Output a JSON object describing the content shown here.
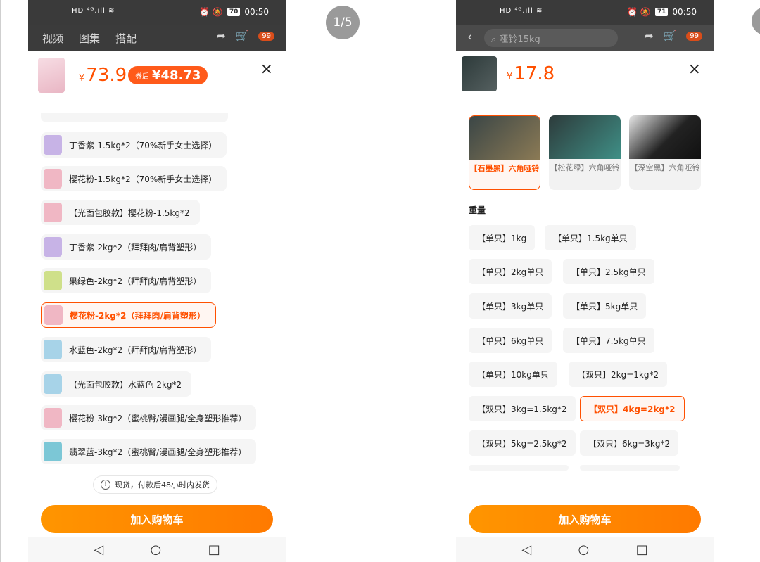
{
  "pager": {
    "label": "1/5"
  },
  "panel1": {
    "status": {
      "left": "HD ⁴ᴳ.ıll ≋",
      "time": "00:50",
      "battery": "70",
      "icons": "⏰ 🔕"
    },
    "nav": {
      "tabs": [
        "视频",
        "图集",
        "搭配"
      ],
      "badge": "99"
    },
    "price_currency": "¥",
    "price": "73.9",
    "coupon_prefix": "券后",
    "coupon_price": "¥48.73",
    "close": "×",
    "options": [
      {
        "label": "丁香紫-1.5kg*2（70%新手女士选择）",
        "color": "#c7b3e6"
      },
      {
        "label": "樱花粉-1.5kg*2（70%新手女士选择）",
        "color": "#f0b7c4"
      },
      {
        "label": "【光面包胶款】樱花粉-1.5kg*2",
        "color": "#f0b7c4"
      },
      {
        "label": "丁香紫-2kg*2（拜拜肉/肩背塑形）",
        "color": "#c7b3e6"
      },
      {
        "label": "果绿色-2kg*2（拜拜肉/肩背塑形）",
        "color": "#cfe08a"
      },
      {
        "label": "樱花粉-2kg*2（拜拜肉/肩背塑形）",
        "color": "#f0b7c4",
        "selected": true
      },
      {
        "label": "水蓝色-2kg*2（拜拜肉/肩背塑形）",
        "color": "#a7d3e8"
      },
      {
        "label": "【光面包胶款】水蓝色-2kg*2",
        "color": "#a7d3e8"
      },
      {
        "label": "樱花粉-3kg*2（蜜桃臀/漫画腿/全身塑形推荐）",
        "color": "#f0b7c4"
      },
      {
        "label": "翡翠蓝-3kg*2（蜜桃臀/漫画腿/全身塑形推荐）",
        "color": "#7cc7d6"
      }
    ],
    "notice": "现货，付款后48小时内发货",
    "cart_button": "加入购物车"
  },
  "panel2": {
    "status": {
      "left": "HD ⁴ᴳ.ıll ≋",
      "time": "00:50",
      "battery": "71",
      "icons": "⏰ 🔕"
    },
    "nav": {
      "search": "哑铃15kg",
      "badge": "99"
    },
    "price_currency": "¥",
    "price": "17.8",
    "close": "×",
    "colors": [
      {
        "label": "【石墨黑】六角哑铃",
        "selected": true
      },
      {
        "label": "【松花绿】六角哑铃"
      },
      {
        "label": "【深空黑】六角哑铃"
      }
    ],
    "weight_title": "重量",
    "weights": [
      "【单只】1kg",
      "【单只】1.5kg单只",
      "【单只】2kg单只",
      "【单只】2.5kg单只",
      "【单只】3kg单只",
      "【单只】5kg单只",
      "【单只】6kg单只",
      "【单只】7.5kg单只",
      "【单只】10kg单只",
      "【双只】2kg=1kg*2",
      "【双只】3kg=1.5kg*2",
      "【双只】4kg=2kg*2",
      "【双只】5kg=2.5kg*2",
      "【双只】6kg=3kg*2"
    ],
    "selected_weight_index": 11,
    "cart_button": "加入购物车"
  },
  "sysnav": {
    "back": "◁",
    "home": "○",
    "recent": "□"
  }
}
